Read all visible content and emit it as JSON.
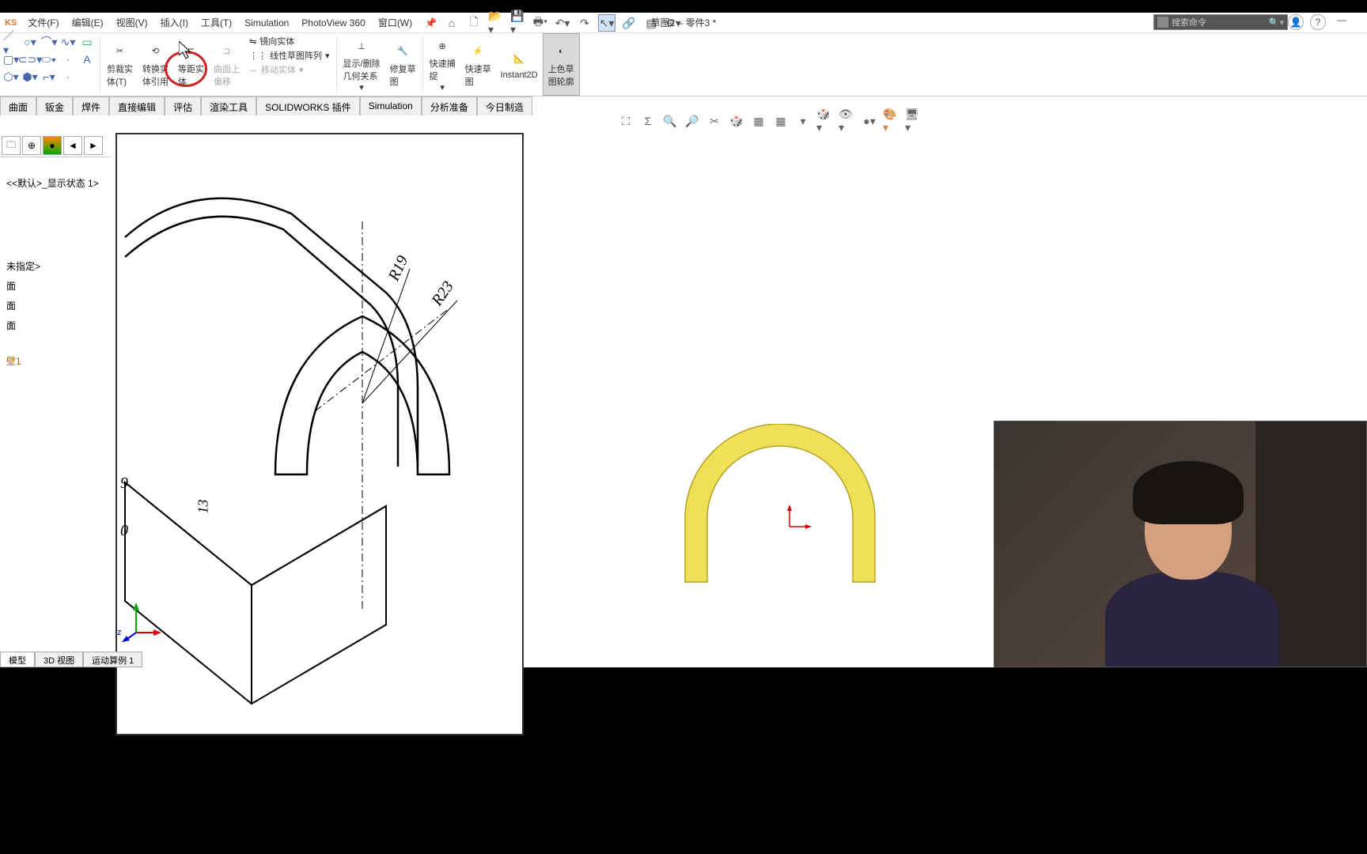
{
  "app": {
    "logo": "KS",
    "title": "草图2 – 零件3 *"
  },
  "menu": {
    "file": "文件(F)",
    "edit": "编辑(E)",
    "view": "视图(V)",
    "insert": "插入(I)",
    "tools": "工具(T)",
    "simulation": "Simulation",
    "photoview": "PhotoView 360",
    "window": "窗口(W)"
  },
  "search": {
    "placeholder": "搜索命令"
  },
  "ribbon": {
    "trim": "剪裁实\n体(T)",
    "convert": "转换实\n体引用",
    "offset": "等距实\n体",
    "face_offset": "曲面上\n偏移",
    "mirror": "镜向实体",
    "pattern": "线性草图阵列",
    "move": "移动实体",
    "display": "显示/删除\n几何关系",
    "repair": "修复草\n图",
    "quick_snap": "快速捕\n捉",
    "rapid": "快速草\n图",
    "instant": "Instant2D",
    "shaded": "上色草\n图轮廓"
  },
  "cmd_tabs": {
    "surface": "曲面",
    "sheet": "钣金",
    "weld": "焊件",
    "direct": "直接编辑",
    "evaluate": "评估",
    "render": "渲染工具",
    "swaddin": "SOLIDWORKS 插件",
    "sim": "Simulation",
    "prep": "分析准备",
    "today": "今日制造"
  },
  "tree": {
    "state": "<<默认>_显示状态 1>",
    "t1": "未指定>",
    "t2": "面",
    "t3": "面",
    "t4": "面",
    "t5": "壁1"
  },
  "drawing": {
    "r19": "R19",
    "r23": "R23",
    "d9": "9",
    "d0": "0",
    "d13": "13"
  },
  "triad": {
    "z": "z"
  },
  "bottom_tabs": {
    "model": "模型",
    "view3d": "3D 视图",
    "motion": "运动算例 1"
  }
}
